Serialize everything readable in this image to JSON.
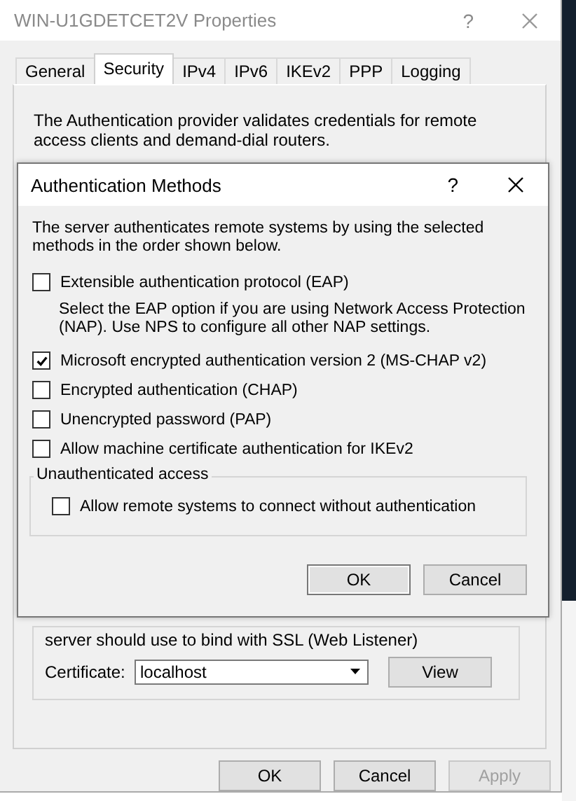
{
  "window": {
    "title": "WIN-U1GDETCET2V Properties",
    "help": "?"
  },
  "tabs": [
    {
      "label": "General",
      "selected": false
    },
    {
      "label": "Security",
      "selected": true
    },
    {
      "label": "IPv4",
      "selected": false
    },
    {
      "label": "IPv6",
      "selected": false
    },
    {
      "label": "IKEv2",
      "selected": false
    },
    {
      "label": "PPP",
      "selected": false
    },
    {
      "label": "Logging",
      "selected": false
    }
  ],
  "panel": {
    "description": "The Authentication provider validates credentials for remote access clients and demand-dial routers.",
    "certificate_group": {
      "text": "server should use to bind with SSL (Web Listener)",
      "label": "Certificate:",
      "value": "localhost",
      "button": "View"
    }
  },
  "buttons": [
    {
      "label": "OK",
      "disabled": false
    },
    {
      "label": "Cancel",
      "disabled": false
    },
    {
      "label": "Apply",
      "disabled": true
    }
  ],
  "dialog": {
    "title": "Authentication Methods",
    "help": "?",
    "description": "The server authenticates remote systems by using the selected methods in the order shown below.",
    "options": [
      {
        "kind": "checkbox",
        "label": "Extensible authentication protocol (EAP)",
        "checked": false
      },
      {
        "kind": "note",
        "label": "Select the EAP option if you are using Network Access Protection (NAP). Use NPS to configure all other NAP settings."
      },
      {
        "kind": "checkbox",
        "label": "Microsoft encrypted authentication version 2 (MS-CHAP v2)",
        "checked": true
      },
      {
        "kind": "checkbox",
        "label": "Encrypted authentication (CHAP)",
        "checked": false
      },
      {
        "kind": "checkbox",
        "label": "Unencrypted password (PAP)",
        "checked": false
      },
      {
        "kind": "checkbox",
        "label": "Allow machine certificate authentication for IKEv2",
        "checked": false
      }
    ],
    "group": {
      "title": "Unauthenticated access",
      "options": [
        {
          "label": "Allow remote systems to connect without authentication",
          "checked": false
        }
      ]
    },
    "buttons": [
      "OK",
      "Cancel"
    ]
  }
}
